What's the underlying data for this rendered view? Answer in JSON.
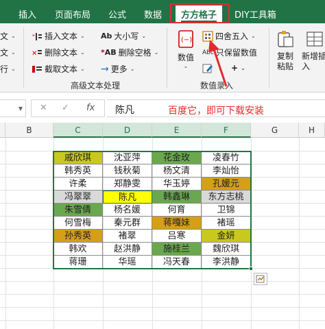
{
  "tabs": [
    {
      "label": "插入"
    },
    {
      "label": "页面布局"
    },
    {
      "label": "公式"
    },
    {
      "label": "数据"
    },
    {
      "label": "方方格子"
    },
    {
      "label": "DIY工具箱"
    }
  ],
  "ribbon": {
    "left_partial": [
      "文",
      "文",
      "行"
    ],
    "text_group": {
      "insert_text": "插入文本",
      "delete_text": "删除文本",
      "extract_text": "截取文本",
      "case": "大小写",
      "delete_spaces": "删除空格",
      "more": "更多",
      "label": "高级文本处理"
    },
    "number_group": {
      "numeric": "数值",
      "round": "四舍五入",
      "keep_value": "只保留数值",
      "plus": "+",
      "label": "数值录入"
    },
    "copy_paste": "复制粘贴",
    "insert_new": "新增插入"
  },
  "formula_bar": {
    "cancel": "✕",
    "confirm": "✓",
    "fx": "fx",
    "value": "陈凡",
    "annotation": "百度它，即可下载安装"
  },
  "grid": {
    "columns": [
      "B",
      "C",
      "D",
      "E",
      "F",
      "G",
      "H"
    ],
    "rows": [
      [
        "戚欣琪",
        "沈亚萍",
        "花金玫",
        "凌春竹"
      ],
      [
        "韩秀英",
        "钱秋菊",
        "杨文清",
        "李灿怡"
      ],
      [
        "许柔",
        "郑静雯",
        "华玉婷",
        "孔媛元"
      ],
      [
        "冯翠翠",
        "陈凡",
        "韩鑫琳",
        "东方志桃"
      ],
      [
        "朱雪倩",
        "杨名媛",
        "何育",
        "卫锦"
      ],
      [
        "何雪梅",
        "秦元群",
        "蒋嘎妹",
        "褚瑶"
      ],
      [
        "孙秀英",
        "褚翠",
        "吕寒",
        "金妍"
      ],
      [
        "韩欢",
        "赵洪静",
        "施桂兰",
        "魏欣琪"
      ],
      [
        "蒋珊",
        "华瑶",
        "冯天春",
        "李洪静"
      ]
    ],
    "highlights": {
      "yellow_olive": "#c8c81e",
      "green": "#6aa84f",
      "gold": "#d4a017",
      "bright_yellow": "#ffff00",
      "gray": "#d9d9d9"
    }
  },
  "colors": {
    "excel_green": "#217346",
    "annotation_red": "#e32b2b"
  }
}
